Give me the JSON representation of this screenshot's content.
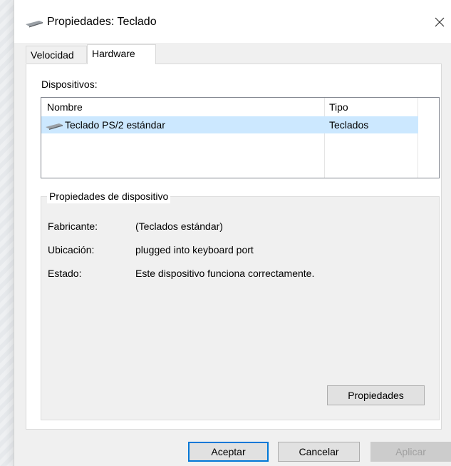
{
  "window": {
    "title": "Propiedades: Teclado",
    "close_glyph": "✕"
  },
  "tabs": [
    {
      "label": "Velocidad",
      "selected": false
    },
    {
      "label": "Hardware",
      "selected": true
    }
  ],
  "devices": {
    "label": "Dispositivos:",
    "columns": [
      "Nombre",
      "Tipo"
    ],
    "rows": [
      {
        "name": "Teclado PS/2 estándar",
        "type": "Teclados",
        "selected": true,
        "icon": "keyboard-icon"
      }
    ]
  },
  "device_properties": {
    "title": "Propiedades de dispositivo",
    "fields": [
      {
        "label": "Fabricante:",
        "value": "(Teclados estándar)"
      },
      {
        "label": "Ubicación:",
        "value": "plugged into keyboard port"
      },
      {
        "label": "Estado:",
        "value": "Este dispositivo funciona correctamente."
      }
    ],
    "properties_button": "Propiedades"
  },
  "footer": {
    "ok_label": "Aceptar",
    "cancel_label": "Cancelar",
    "apply_label": "Aplicar"
  },
  "colors": {
    "selection": "#cce8ff",
    "accent": "#0078d7",
    "window_bg": "#f0f0f0"
  }
}
